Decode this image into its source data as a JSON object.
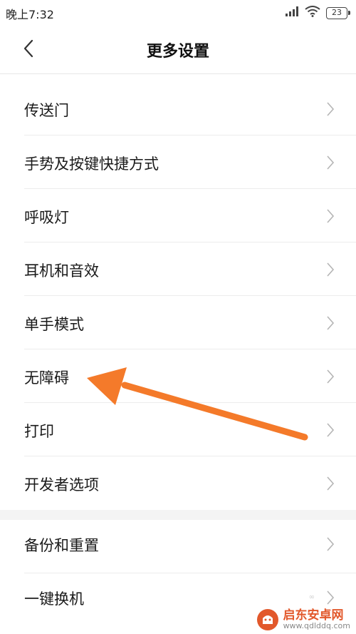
{
  "status_bar": {
    "time": "晚上7:32",
    "battery": "23",
    "signal_icon": "signal-icon",
    "wifi_icon": "wifi-icon"
  },
  "header": {
    "title": "更多设置",
    "back_icon": "chevron-left-icon"
  },
  "list": {
    "items": [
      {
        "label": "传送门"
      },
      {
        "label": "手势及按键快捷方式"
      },
      {
        "label": "呼吸灯"
      },
      {
        "label": "耳机和音效"
      },
      {
        "label": "单手模式"
      },
      {
        "label": "无障碍"
      },
      {
        "label": "打印"
      },
      {
        "label": "开发者选项"
      }
    ]
  },
  "list2": {
    "items": [
      {
        "label": "备份和重置"
      },
      {
        "label": "一键换机"
      }
    ]
  },
  "annotation": {
    "arrow_color": "#f47a2a",
    "points_to": "无障碍"
  },
  "watermark": {
    "name": "启东安卓网",
    "url": "www.qdlddq.com"
  },
  "colors": {
    "text": "#1a1a1a",
    "chevron": "#b5b5b5",
    "divider": "#ececec",
    "section_gap": "#f4f4f4"
  }
}
